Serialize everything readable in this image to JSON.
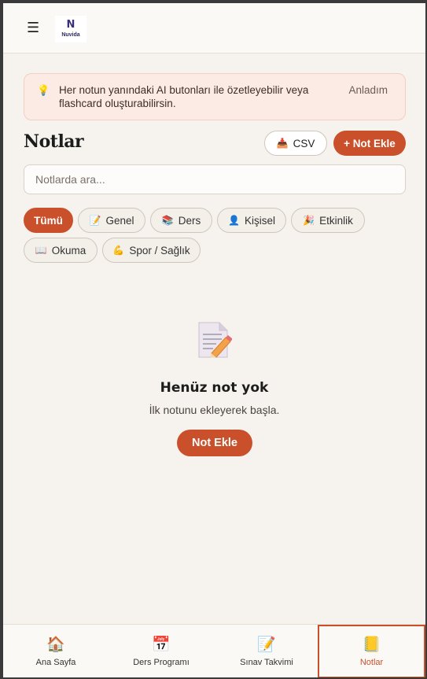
{
  "header": {
    "menu_icon": "hamburger-icon",
    "logo_text": "Nuvida",
    "logo_mark": "N"
  },
  "tip": {
    "icon": "lightbulb-icon",
    "text": "Her notun yanındaki AI butonları ile özetleyebilir veya flashcard oluşturabilirsin.",
    "dismiss_label": "Anladım"
  },
  "page": {
    "title": "Notlar",
    "csv_label": "CSV",
    "add_label": "+ Not Ekle"
  },
  "search": {
    "placeholder": "Notlarda ara..."
  },
  "filters": [
    {
      "label": "Tümü",
      "icon": "",
      "active": true
    },
    {
      "label": "Genel",
      "icon": "📝"
    },
    {
      "label": "Ders",
      "icon": "📚"
    },
    {
      "label": "Kişisel",
      "icon": "👤"
    },
    {
      "label": "Etkinlik",
      "icon": "🎉"
    },
    {
      "label": "Okuma",
      "icon": "📖"
    },
    {
      "label": "Spor / Sağlık",
      "icon": "💪"
    }
  ],
  "empty": {
    "title": "Henüz not yok",
    "subtitle": "İlk notunu ekleyerek başla.",
    "button_label": "Not Ekle"
  },
  "nav": [
    {
      "label": "Ana Sayfa",
      "icon": "🏠"
    },
    {
      "label": "Ders Programı",
      "icon": "📅"
    },
    {
      "label": "Sınav Takvimi",
      "icon": "📝"
    },
    {
      "label": "Notlar",
      "icon": "📒",
      "active": true
    }
  ],
  "colors": {
    "accent": "#c9502b",
    "background": "#f6f3ee",
    "tip_background": "#fcebe4"
  }
}
